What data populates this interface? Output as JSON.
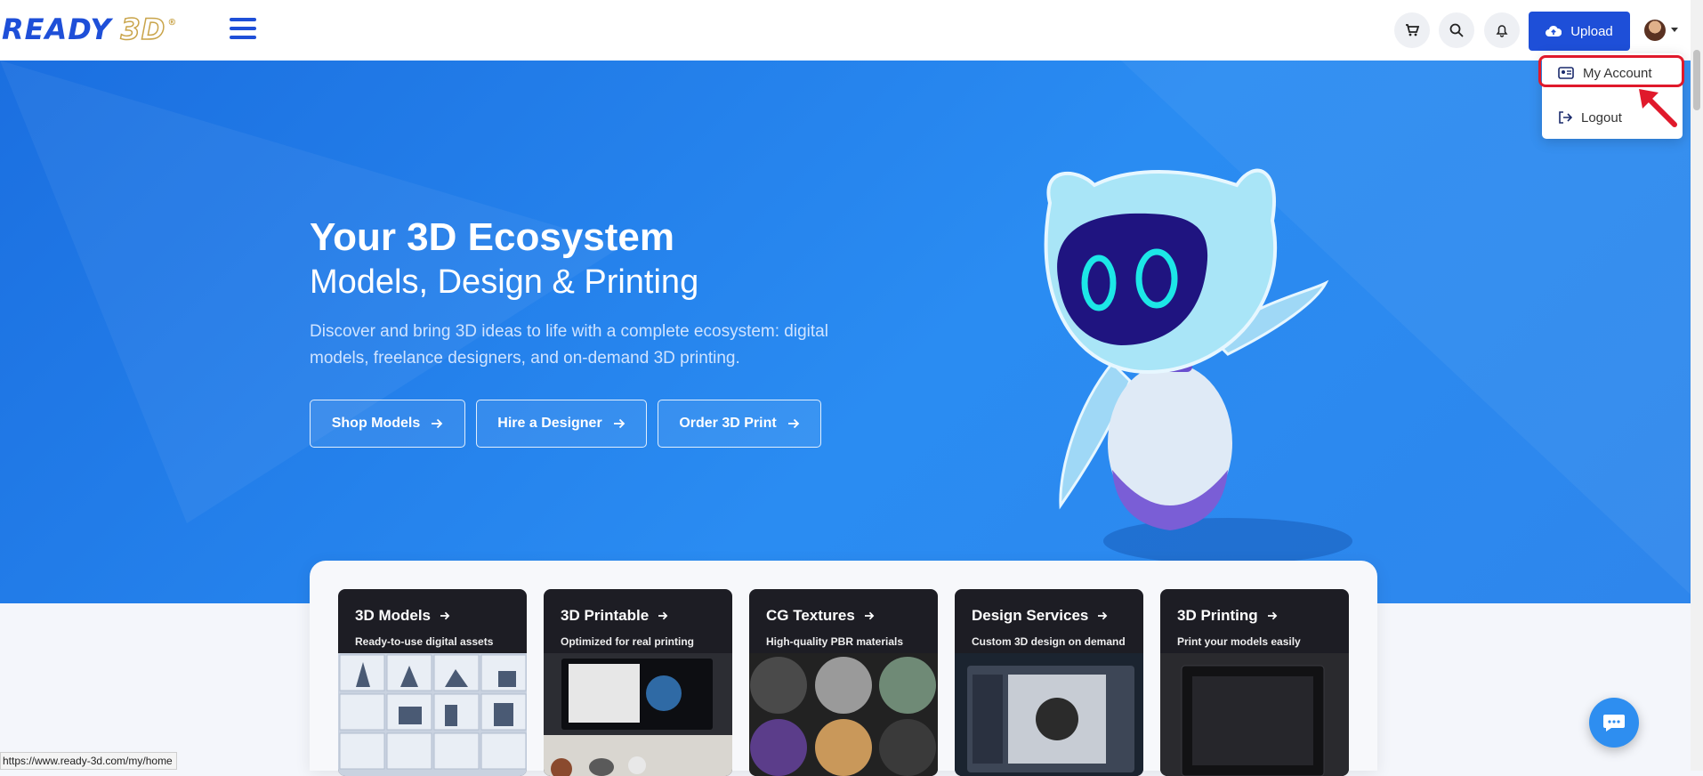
{
  "header": {
    "logo_text": "READY",
    "logo_3d": "3D",
    "logo_reg": "®",
    "upload_label": "Upload",
    "icons": [
      "cart-icon",
      "search-icon",
      "bell-icon",
      "cloud-upload-icon"
    ]
  },
  "account_menu": {
    "items": [
      {
        "label": "My Account",
        "icon": "id-card-icon",
        "highlighted": true
      },
      {
        "label": "Logout",
        "icon": "logout-icon"
      }
    ]
  },
  "hero": {
    "title": "Your 3D Ecosystem",
    "subtitle": "Models, Design & Printing",
    "description": "Discover and bring 3D ideas to life with a complete ecosystem: digital models, freelance designers, and on-demand 3D printing.",
    "buttons": [
      {
        "label": "Shop Models"
      },
      {
        "label": "Hire a Designer"
      },
      {
        "label": "Order 3D Print"
      }
    ]
  },
  "categories": [
    {
      "title": "3D Models",
      "subtitle": "Ready-to-use digital assets"
    },
    {
      "title": "3D Printable",
      "subtitle": "Optimized for real printing"
    },
    {
      "title": "CG Textures",
      "subtitle": "High-quality PBR materials"
    },
    {
      "title": "Design Services",
      "subtitle": "Custom 3D design on demand"
    },
    {
      "title": "3D Printing",
      "subtitle": "Print your models easily"
    }
  ],
  "status_bar": {
    "url": "https://www.ready-3d.com/my/home"
  },
  "colors": {
    "brand": "#1e4fd8",
    "hero": "#2a8cf2",
    "highlight": "#e0192b",
    "logo_gold": "#c9a44a"
  }
}
